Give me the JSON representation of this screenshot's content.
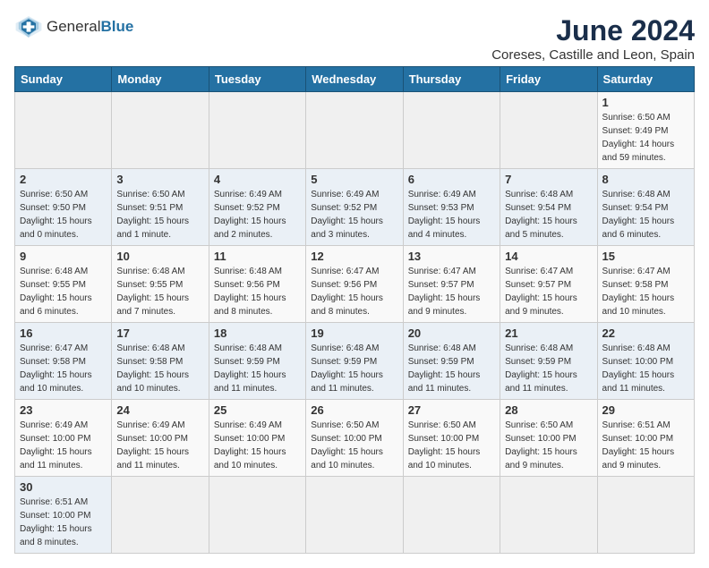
{
  "header": {
    "logo_text_general": "General",
    "logo_text_blue": "Blue",
    "month_title": "June 2024",
    "location": "Coreses, Castille and Leon, Spain"
  },
  "weekdays": [
    "Sunday",
    "Monday",
    "Tuesday",
    "Wednesday",
    "Thursday",
    "Friday",
    "Saturday"
  ],
  "weeks": [
    [
      {
        "day": "",
        "info": ""
      },
      {
        "day": "",
        "info": ""
      },
      {
        "day": "",
        "info": ""
      },
      {
        "day": "",
        "info": ""
      },
      {
        "day": "",
        "info": ""
      },
      {
        "day": "",
        "info": ""
      },
      {
        "day": "1",
        "info": "Sunrise: 6:50 AM\nSunset: 9:49 PM\nDaylight: 14 hours\nand 59 minutes."
      }
    ],
    [
      {
        "day": "2",
        "info": "Sunrise: 6:50 AM\nSunset: 9:50 PM\nDaylight: 15 hours\nand 0 minutes."
      },
      {
        "day": "3",
        "info": "Sunrise: 6:50 AM\nSunset: 9:51 PM\nDaylight: 15 hours\nand 1 minute."
      },
      {
        "day": "4",
        "info": "Sunrise: 6:49 AM\nSunset: 9:52 PM\nDaylight: 15 hours\nand 2 minutes."
      },
      {
        "day": "5",
        "info": "Sunrise: 6:49 AM\nSunset: 9:52 PM\nDaylight: 15 hours\nand 3 minutes."
      },
      {
        "day": "6",
        "info": "Sunrise: 6:49 AM\nSunset: 9:53 PM\nDaylight: 15 hours\nand 4 minutes."
      },
      {
        "day": "7",
        "info": "Sunrise: 6:48 AM\nSunset: 9:54 PM\nDaylight: 15 hours\nand 5 minutes."
      },
      {
        "day": "8",
        "info": "Sunrise: 6:48 AM\nSunset: 9:54 PM\nDaylight: 15 hours\nand 6 minutes."
      }
    ],
    [
      {
        "day": "9",
        "info": "Sunrise: 6:48 AM\nSunset: 9:55 PM\nDaylight: 15 hours\nand 6 minutes."
      },
      {
        "day": "10",
        "info": "Sunrise: 6:48 AM\nSunset: 9:55 PM\nDaylight: 15 hours\nand 7 minutes."
      },
      {
        "day": "11",
        "info": "Sunrise: 6:48 AM\nSunset: 9:56 PM\nDaylight: 15 hours\nand 8 minutes."
      },
      {
        "day": "12",
        "info": "Sunrise: 6:47 AM\nSunset: 9:56 PM\nDaylight: 15 hours\nand 8 minutes."
      },
      {
        "day": "13",
        "info": "Sunrise: 6:47 AM\nSunset: 9:57 PM\nDaylight: 15 hours\nand 9 minutes."
      },
      {
        "day": "14",
        "info": "Sunrise: 6:47 AM\nSunset: 9:57 PM\nDaylight: 15 hours\nand 9 minutes."
      },
      {
        "day": "15",
        "info": "Sunrise: 6:47 AM\nSunset: 9:58 PM\nDaylight: 15 hours\nand 10 minutes."
      }
    ],
    [
      {
        "day": "16",
        "info": "Sunrise: 6:47 AM\nSunset: 9:58 PM\nDaylight: 15 hours\nand 10 minutes."
      },
      {
        "day": "17",
        "info": "Sunrise: 6:48 AM\nSunset: 9:58 PM\nDaylight: 15 hours\nand 10 minutes."
      },
      {
        "day": "18",
        "info": "Sunrise: 6:48 AM\nSunset: 9:59 PM\nDaylight: 15 hours\nand 11 minutes."
      },
      {
        "day": "19",
        "info": "Sunrise: 6:48 AM\nSunset: 9:59 PM\nDaylight: 15 hours\nand 11 minutes."
      },
      {
        "day": "20",
        "info": "Sunrise: 6:48 AM\nSunset: 9:59 PM\nDaylight: 15 hours\nand 11 minutes."
      },
      {
        "day": "21",
        "info": "Sunrise: 6:48 AM\nSunset: 9:59 PM\nDaylight: 15 hours\nand 11 minutes."
      },
      {
        "day": "22",
        "info": "Sunrise: 6:48 AM\nSunset: 10:00 PM\nDaylight: 15 hours\nand 11 minutes."
      }
    ],
    [
      {
        "day": "23",
        "info": "Sunrise: 6:49 AM\nSunset: 10:00 PM\nDaylight: 15 hours\nand 11 minutes."
      },
      {
        "day": "24",
        "info": "Sunrise: 6:49 AM\nSunset: 10:00 PM\nDaylight: 15 hours\nand 11 minutes."
      },
      {
        "day": "25",
        "info": "Sunrise: 6:49 AM\nSunset: 10:00 PM\nDaylight: 15 hours\nand 10 minutes."
      },
      {
        "day": "26",
        "info": "Sunrise: 6:50 AM\nSunset: 10:00 PM\nDaylight: 15 hours\nand 10 minutes."
      },
      {
        "day": "27",
        "info": "Sunrise: 6:50 AM\nSunset: 10:00 PM\nDaylight: 15 hours\nand 10 minutes."
      },
      {
        "day": "28",
        "info": "Sunrise: 6:50 AM\nSunset: 10:00 PM\nDaylight: 15 hours\nand 9 minutes."
      },
      {
        "day": "29",
        "info": "Sunrise: 6:51 AM\nSunset: 10:00 PM\nDaylight: 15 hours\nand 9 minutes."
      }
    ],
    [
      {
        "day": "30",
        "info": "Sunrise: 6:51 AM\nSunset: 10:00 PM\nDaylight: 15 hours\nand 8 minutes."
      },
      {
        "day": "",
        "info": ""
      },
      {
        "day": "",
        "info": ""
      },
      {
        "day": "",
        "info": ""
      },
      {
        "day": "",
        "info": ""
      },
      {
        "day": "",
        "info": ""
      },
      {
        "day": "",
        "info": ""
      }
    ]
  ]
}
